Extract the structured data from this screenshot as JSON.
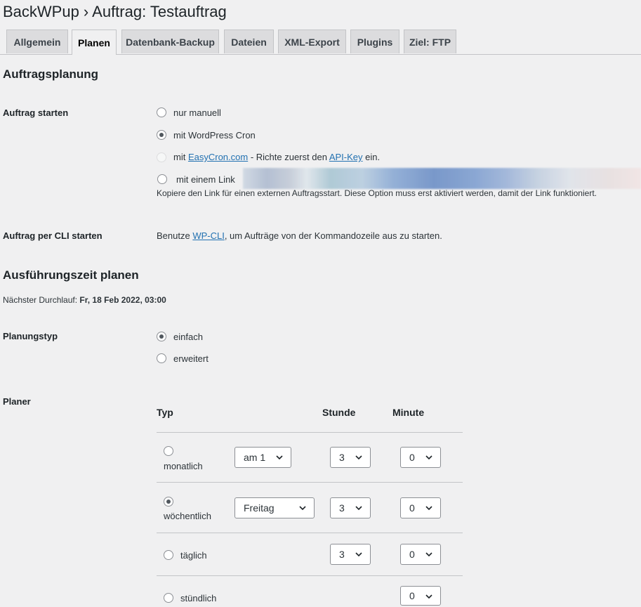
{
  "page_title": "BackWPup › Auftrag: Testauftrag",
  "tabs": [
    {
      "label": "Allgemein"
    },
    {
      "label": "Planen"
    },
    {
      "label": "Datenbank-Backup"
    },
    {
      "label": "Dateien"
    },
    {
      "label": "XML-Export"
    },
    {
      "label": "Plugins"
    },
    {
      "label": "Ziel: FTP"
    }
  ],
  "active_tab": "Planen",
  "section_scheduling": {
    "title": "Auftragsplanung",
    "start_label": "Auftrag starten",
    "options": {
      "manual": "nur manuell",
      "wp_cron": "mit WordPress Cron",
      "easycron_prefix": "mit ",
      "easycron_link": "EasyCron.com",
      "easycron_middle": " - Richte zuerst den ",
      "easycron_apikey": "API-Key",
      "easycron_suffix": " ein.",
      "link": "mit einem Link"
    },
    "selected": "wp_cron",
    "link_description": "Kopiere den Link für einen externen Auftragsstart. Diese Option muss erst aktiviert werden, damit der Link funktioniert.",
    "cli_label": "Auftrag per CLI starten",
    "cli_prefix": "Benutze ",
    "cli_link": "WP-CLI",
    "cli_suffix": ", um Aufträge von der Kommandozeile aus zu starten."
  },
  "section_time": {
    "title": "Ausführungszeit planen",
    "next_run_label": "Nächster Durchlauf: ",
    "next_run_value": "Fr, 18 Feb 2022, 03:00",
    "type_label": "Planungstyp",
    "type_simple": "einfach",
    "type_advanced": "erweitert",
    "type_selected": "einfach",
    "planner_label": "Planer",
    "columns": {
      "type": "Typ",
      "hour": "Stunde",
      "minute": "Minute"
    },
    "rows": [
      {
        "label": "monatlich",
        "day": "am 1",
        "hour": "3",
        "minute": "0",
        "checked": false
      },
      {
        "label": "wöchentlich",
        "day": "Freitag",
        "hour": "3",
        "minute": "0",
        "checked": true
      },
      {
        "label": "täglich",
        "hour": "3",
        "minute": "0",
        "checked": false
      },
      {
        "label": "stündlich",
        "minute": "0",
        "checked": false
      }
    ]
  }
}
